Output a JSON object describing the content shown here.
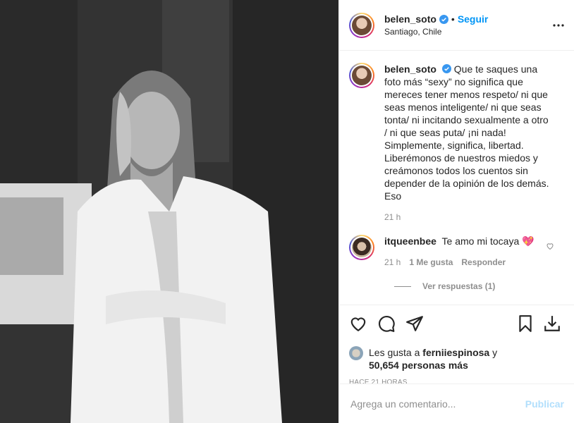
{
  "post": {
    "username": "belen_soto",
    "follow_label": "Seguir",
    "location": "Santiago, Chile"
  },
  "caption": {
    "username": "belen_soto",
    "text": "Que te saques una foto más “sexy” no significa que mereces tener menos respeto/ ni que seas menos inteligente/ ni que seas tonta/ ni incitando sexualmente a otro / ni que seas puta/ ¡ni nada! Simplemente, significa, libertad. Liberémonos de nuestros miedos y creámonos todos los cuentos sin depender de la opinión de los demás. Eso",
    "time": "21 h"
  },
  "comment": {
    "username": "itqueenbee",
    "text": "Te amo mi tocaya 💖",
    "time": "21 h",
    "likes": "1 Me gusta",
    "reply_label": "Responder",
    "view_replies": "Ver respuestas (1)"
  },
  "likes": {
    "prefix": "Les gusta a ",
    "user": "ferniiespinosa",
    "middle": " y",
    "others": "50,654 personas más"
  },
  "time_ago": "HACE 21 HORAS",
  "add_comment": {
    "placeholder": "Agrega un comentario...",
    "publish_label": "Publicar"
  },
  "icons": [
    "verified-badge-icon",
    "more-options-icon",
    "like-heart-icon",
    "comment-bubble-icon",
    "share-paper-plane-icon",
    "save-bookmark-icon",
    "download-icon",
    "small-heart-icon"
  ]
}
